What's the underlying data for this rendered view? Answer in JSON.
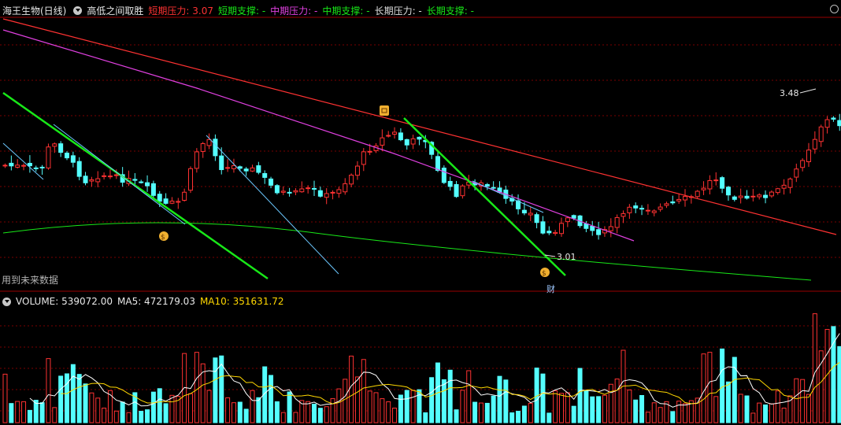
{
  "top_bar": {
    "stock_name": "海王生物(日线)",
    "indicator_name": "高低之间取胜",
    "legend": [
      {
        "label": "短期压力: 3.07",
        "color": "#ff3232"
      },
      {
        "label": "短期支撑: -",
        "color": "#18e818"
      },
      {
        "label": "中期压力: -",
        "color": "#e040e0"
      },
      {
        "label": "中期支撑: -",
        "color": "#18e818"
      },
      {
        "label": "长期压力: -",
        "color": "#e0e0e0"
      },
      {
        "label": "长期支撑: -",
        "color": "#18e818"
      }
    ]
  },
  "main_panel": {
    "note": "用到未来数据",
    "high_label": "3.48",
    "low_label": "3.01",
    "finance_marker": "财"
  },
  "volume_panel": {
    "volume_label": "VOLUME: 539072.00",
    "ma5_label": "MA5: 472179.03",
    "ma10_label": "MA10: 351631.72"
  },
  "colors": {
    "background": "#000000",
    "up": "#ff3232",
    "down": "#54ffff",
    "short_pressure": "#ff3232",
    "short_support": "#18e818",
    "mid_pressure": "#e040e0",
    "long_support": "#18e818",
    "ma5": "#ffffff",
    "ma10": "#ffd700",
    "grid": "#7a0000"
  }
}
